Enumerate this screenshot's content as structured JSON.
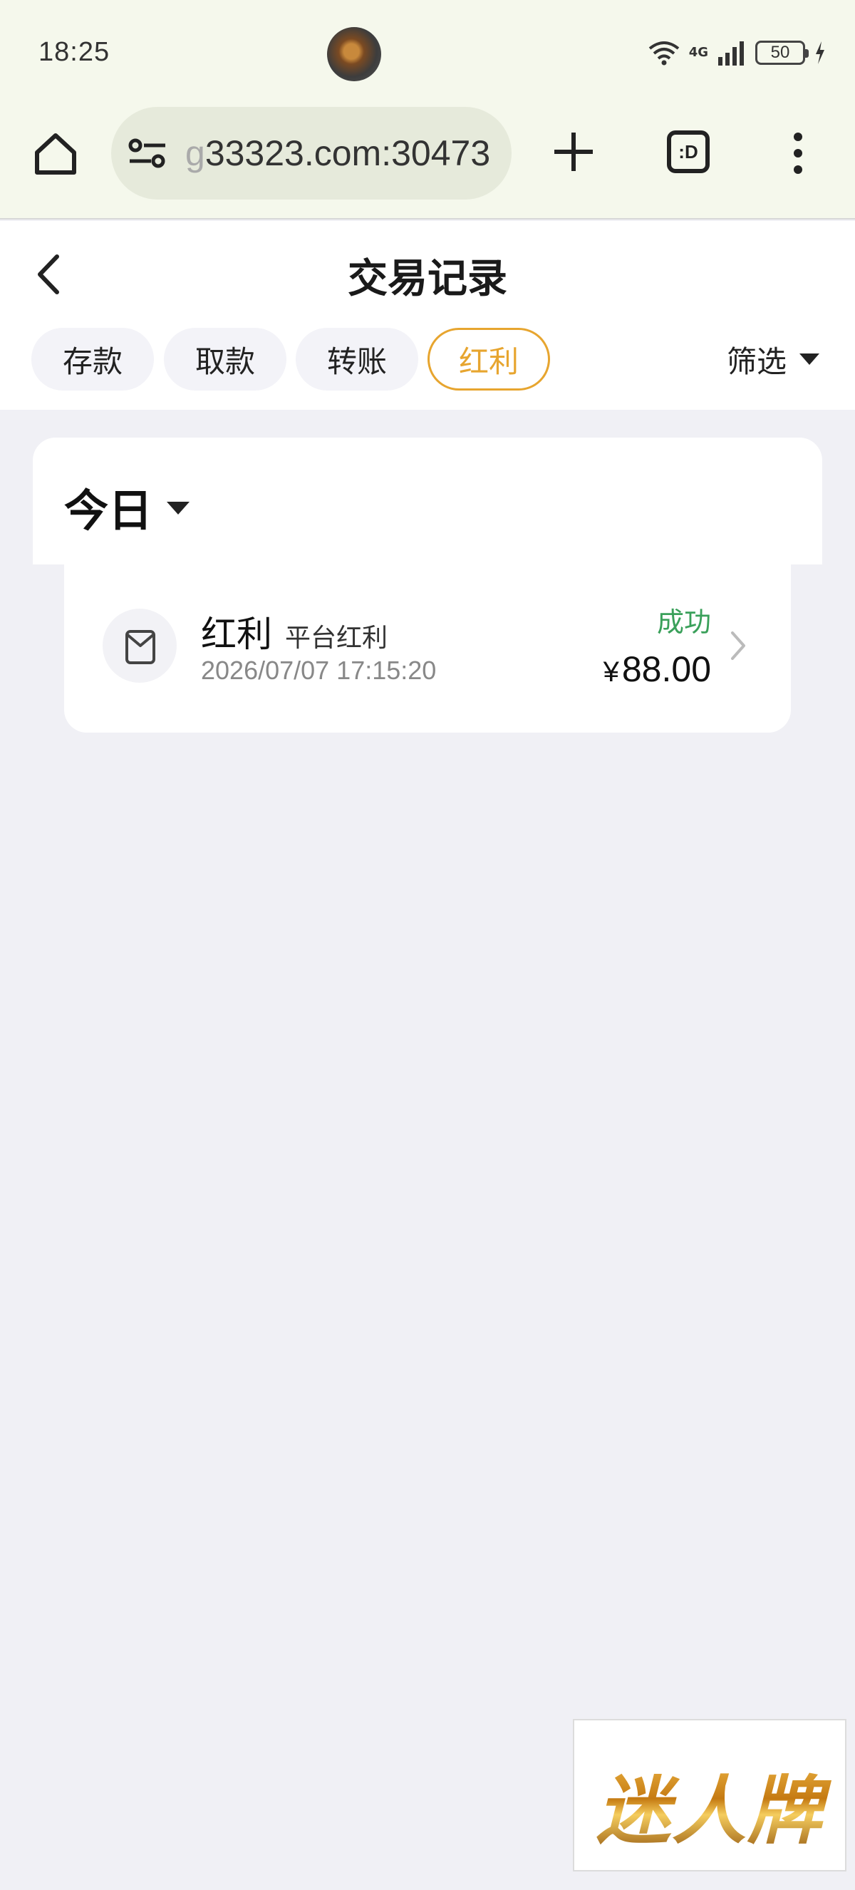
{
  "status_bar": {
    "time": "18:25",
    "network": "4G",
    "battery": "50"
  },
  "browser": {
    "url_prefix": "g",
    "url": "33323.com:30473"
  },
  "header": {
    "title": "交易记录",
    "tabs": [
      {
        "label": "存款",
        "active": false
      },
      {
        "label": "取款",
        "active": false
      },
      {
        "label": "转账",
        "active": false
      },
      {
        "label": "红利",
        "active": true
      }
    ],
    "filter_label": "筛选"
  },
  "day_group": {
    "label": "今日"
  },
  "records": [
    {
      "title": "红利",
      "subtitle": "平台红利",
      "time": "2026/07/07 17:15:20",
      "status": "成功",
      "currency": "¥",
      "amount": "88.00"
    }
  ],
  "colors": {
    "accent": "#e7a52f",
    "success": "#3aa05a",
    "page_bg": "#f0f0f5",
    "browser_bg": "#f5f8ec"
  },
  "brand": {
    "logo_text": "迷人牌"
  }
}
